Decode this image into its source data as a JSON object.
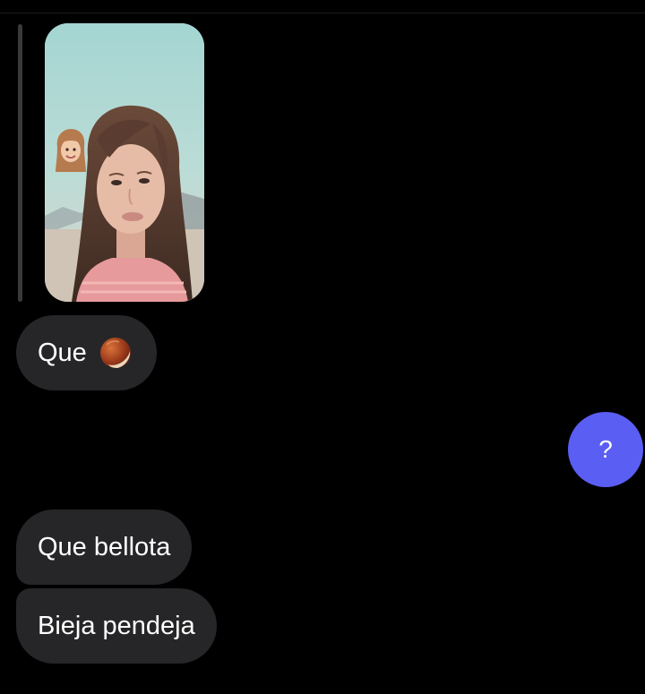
{
  "conversation": {
    "messages": [
      {
        "sender": "other",
        "type": "story_reply_image",
        "badge_icon": "memoji-girl-icon"
      },
      {
        "sender": "other",
        "text": "Que",
        "emoji_icon": "acorn-emoji-icon"
      },
      {
        "sender": "me",
        "text": "?",
        "color": "#5a5ef3"
      },
      {
        "sender": "other",
        "text": "Que bellota"
      },
      {
        "sender": "other",
        "text": "Bieja pendeja"
      }
    ]
  },
  "colors": {
    "background": "#000000",
    "incoming_bubble": "#262628",
    "outgoing_bubble": "#5a5ef3",
    "text": "#ffffff"
  }
}
